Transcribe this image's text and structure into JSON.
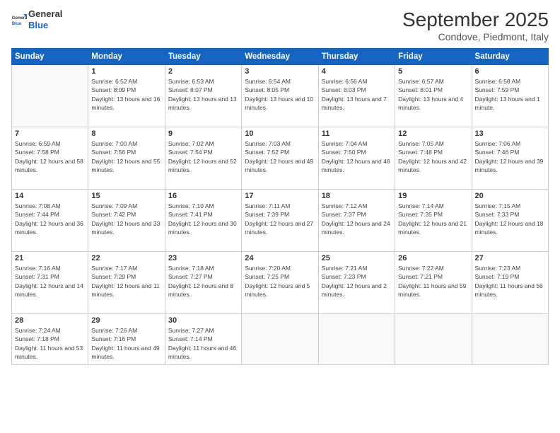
{
  "header": {
    "logo_general": "General",
    "logo_blue": "Blue",
    "month_year": "September 2025",
    "location": "Condove, Piedmont, Italy"
  },
  "days": [
    "Sunday",
    "Monday",
    "Tuesday",
    "Wednesday",
    "Thursday",
    "Friday",
    "Saturday"
  ],
  "weeks": [
    [
      {
        "date": "",
        "sunrise": "",
        "sunset": "",
        "daylight": ""
      },
      {
        "date": "1",
        "sunrise": "Sunrise: 6:52 AM",
        "sunset": "Sunset: 8:09 PM",
        "daylight": "Daylight: 13 hours and 16 minutes."
      },
      {
        "date": "2",
        "sunrise": "Sunrise: 6:53 AM",
        "sunset": "Sunset: 8:07 PM",
        "daylight": "Daylight: 13 hours and 13 minutes."
      },
      {
        "date": "3",
        "sunrise": "Sunrise: 6:54 AM",
        "sunset": "Sunset: 8:05 PM",
        "daylight": "Daylight: 13 hours and 10 minutes."
      },
      {
        "date": "4",
        "sunrise": "Sunrise: 6:56 AM",
        "sunset": "Sunset: 8:03 PM",
        "daylight": "Daylight: 13 hours and 7 minutes."
      },
      {
        "date": "5",
        "sunrise": "Sunrise: 6:57 AM",
        "sunset": "Sunset: 8:01 PM",
        "daylight": "Daylight: 13 hours and 4 minutes."
      },
      {
        "date": "6",
        "sunrise": "Sunrise: 6:58 AM",
        "sunset": "Sunset: 7:59 PM",
        "daylight": "Daylight: 13 hours and 1 minute."
      }
    ],
    [
      {
        "date": "7",
        "sunrise": "Sunrise: 6:59 AM",
        "sunset": "Sunset: 7:58 PM",
        "daylight": "Daylight: 12 hours and 58 minutes."
      },
      {
        "date": "8",
        "sunrise": "Sunrise: 7:00 AM",
        "sunset": "Sunset: 7:56 PM",
        "daylight": "Daylight: 12 hours and 55 minutes."
      },
      {
        "date": "9",
        "sunrise": "Sunrise: 7:02 AM",
        "sunset": "Sunset: 7:54 PM",
        "daylight": "Daylight: 12 hours and 52 minutes."
      },
      {
        "date": "10",
        "sunrise": "Sunrise: 7:03 AM",
        "sunset": "Sunset: 7:52 PM",
        "daylight": "Daylight: 12 hours and 49 minutes."
      },
      {
        "date": "11",
        "sunrise": "Sunrise: 7:04 AM",
        "sunset": "Sunset: 7:50 PM",
        "daylight": "Daylight: 12 hours and 46 minutes."
      },
      {
        "date": "12",
        "sunrise": "Sunrise: 7:05 AM",
        "sunset": "Sunset: 7:48 PM",
        "daylight": "Daylight: 12 hours and 42 minutes."
      },
      {
        "date": "13",
        "sunrise": "Sunrise: 7:06 AM",
        "sunset": "Sunset: 7:46 PM",
        "daylight": "Daylight: 12 hours and 39 minutes."
      }
    ],
    [
      {
        "date": "14",
        "sunrise": "Sunrise: 7:08 AM",
        "sunset": "Sunset: 7:44 PM",
        "daylight": "Daylight: 12 hours and 36 minutes."
      },
      {
        "date": "15",
        "sunrise": "Sunrise: 7:09 AM",
        "sunset": "Sunset: 7:42 PM",
        "daylight": "Daylight: 12 hours and 33 minutes."
      },
      {
        "date": "16",
        "sunrise": "Sunrise: 7:10 AM",
        "sunset": "Sunset: 7:41 PM",
        "daylight": "Daylight: 12 hours and 30 minutes."
      },
      {
        "date": "17",
        "sunrise": "Sunrise: 7:11 AM",
        "sunset": "Sunset: 7:39 PM",
        "daylight": "Daylight: 12 hours and 27 minutes."
      },
      {
        "date": "18",
        "sunrise": "Sunrise: 7:12 AM",
        "sunset": "Sunset: 7:37 PM",
        "daylight": "Daylight: 12 hours and 24 minutes."
      },
      {
        "date": "19",
        "sunrise": "Sunrise: 7:14 AM",
        "sunset": "Sunset: 7:35 PM",
        "daylight": "Daylight: 12 hours and 21 minutes."
      },
      {
        "date": "20",
        "sunrise": "Sunrise: 7:15 AM",
        "sunset": "Sunset: 7:33 PM",
        "daylight": "Daylight: 12 hours and 18 minutes."
      }
    ],
    [
      {
        "date": "21",
        "sunrise": "Sunrise: 7:16 AM",
        "sunset": "Sunset: 7:31 PM",
        "daylight": "Daylight: 12 hours and 14 minutes."
      },
      {
        "date": "22",
        "sunrise": "Sunrise: 7:17 AM",
        "sunset": "Sunset: 7:29 PM",
        "daylight": "Daylight: 12 hours and 11 minutes."
      },
      {
        "date": "23",
        "sunrise": "Sunrise: 7:18 AM",
        "sunset": "Sunset: 7:27 PM",
        "daylight": "Daylight: 12 hours and 8 minutes."
      },
      {
        "date": "24",
        "sunrise": "Sunrise: 7:20 AM",
        "sunset": "Sunset: 7:25 PM",
        "daylight": "Daylight: 12 hours and 5 minutes."
      },
      {
        "date": "25",
        "sunrise": "Sunrise: 7:21 AM",
        "sunset": "Sunset: 7:23 PM",
        "daylight": "Daylight: 12 hours and 2 minutes."
      },
      {
        "date": "26",
        "sunrise": "Sunrise: 7:22 AM",
        "sunset": "Sunset: 7:21 PM",
        "daylight": "Daylight: 11 hours and 59 minutes."
      },
      {
        "date": "27",
        "sunrise": "Sunrise: 7:23 AM",
        "sunset": "Sunset: 7:19 PM",
        "daylight": "Daylight: 11 hours and 56 minutes."
      }
    ],
    [
      {
        "date": "28",
        "sunrise": "Sunrise: 7:24 AM",
        "sunset": "Sunset: 7:18 PM",
        "daylight": "Daylight: 11 hours and 53 minutes."
      },
      {
        "date": "29",
        "sunrise": "Sunrise: 7:26 AM",
        "sunset": "Sunset: 7:16 PM",
        "daylight": "Daylight: 11 hours and 49 minutes."
      },
      {
        "date": "30",
        "sunrise": "Sunrise: 7:27 AM",
        "sunset": "Sunset: 7:14 PM",
        "daylight": "Daylight: 11 hours and 46 minutes."
      },
      {
        "date": "",
        "sunrise": "",
        "sunset": "",
        "daylight": ""
      },
      {
        "date": "",
        "sunrise": "",
        "sunset": "",
        "daylight": ""
      },
      {
        "date": "",
        "sunrise": "",
        "sunset": "",
        "daylight": ""
      },
      {
        "date": "",
        "sunrise": "",
        "sunset": "",
        "daylight": ""
      }
    ]
  ]
}
